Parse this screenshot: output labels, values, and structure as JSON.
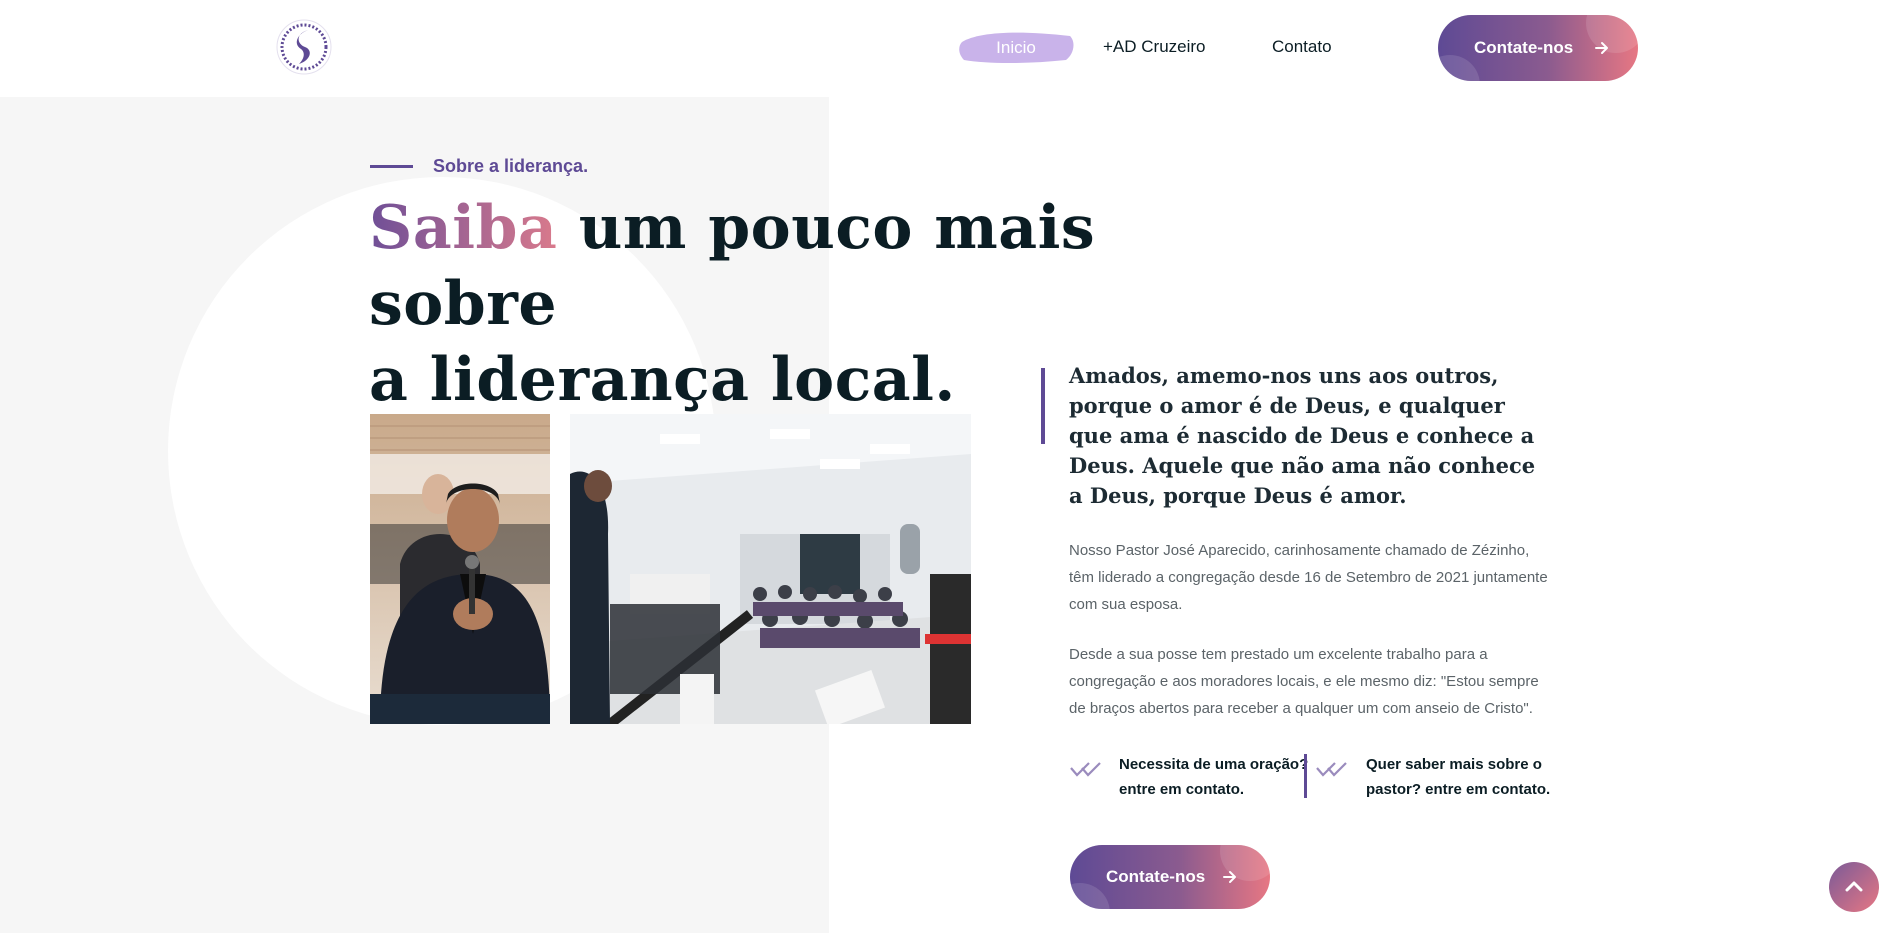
{
  "header": {
    "nav": [
      {
        "label": "Inicio",
        "active": true
      },
      {
        "label": "+AD Cruzeiro",
        "active": false
      },
      {
        "label": "Contato",
        "active": false
      }
    ],
    "cta_label": "Contate-nos"
  },
  "hero": {
    "eyebrow": "Sobre a liderança.",
    "headline_accent": "Saiba",
    "headline_rest_line1": " um pouco mais sobre",
    "headline_line2": "a liderança local."
  },
  "content": {
    "quote": "Amados, amemo-nos uns aos outros, porque o amor é de Deus, e qualquer que ama é nascido de Deus e conhece a Deus. Aquele que não ama não conhece a Deus, porque Deus é amor.",
    "paragraph1": "Nosso Pastor José Aparecido, carinhosamente chamado de Zézinho, têm liderado a congregação desde 16 de Setembro de 2021 juntamente com sua esposa.",
    "paragraph2": "Desde a sua posse tem prestado um excelente trabalho para a congregação e aos moradores locais, e ele mesmo diz: \"Estou sempre de braços abertos para receber a qualquer um com anseio de Cristo\".",
    "feature1": "Necessita de uma oração? entre em contato.",
    "feature2": "Quer saber mais sobre o pastor? entre em contato.",
    "cta_label": "Contate-nos"
  },
  "colors": {
    "brand_purple": "#5e4a95",
    "brand_pink": "#e77783",
    "heading": "#0b1d24"
  },
  "icons": [
    "logo-icon",
    "arrow-right-icon",
    "double-check-icon",
    "chevron-up-icon"
  ]
}
